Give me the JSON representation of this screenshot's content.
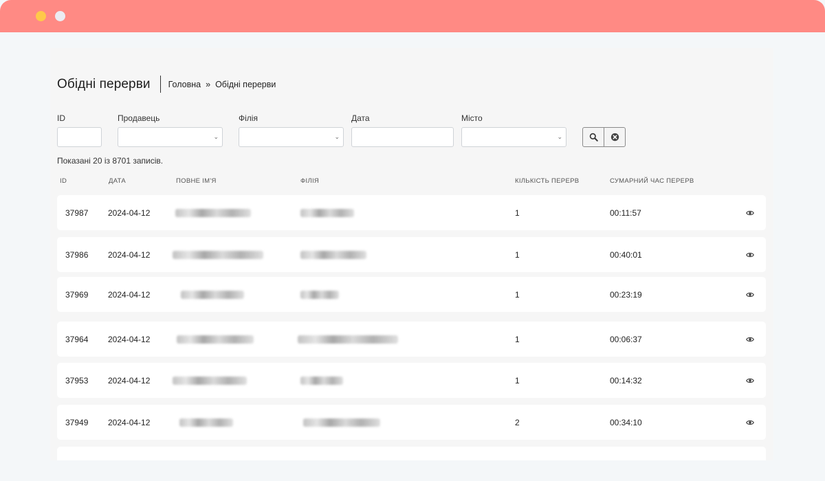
{
  "window": {
    "accent": "#ff8a84"
  },
  "header": {
    "title": "Обідні перерви",
    "breadcrumb": {
      "home": "Головна",
      "separator": "»",
      "current": "Обідні перерви"
    }
  },
  "filters": {
    "id_label": "ID",
    "seller_label": "Продавець",
    "branch_label": "Філія",
    "date_label": "Дата",
    "city_label": "Місто",
    "search_icon": "search-icon",
    "clear_icon": "clear-icon"
  },
  "summary": "Показані 20 із 8701 записів.",
  "table": {
    "columns": [
      "ID",
      "ДАТА",
      "ПОВНЕ ІМ'Я",
      "ФІЛІЯ",
      "КІЛЬКІСТЬ ПЕРЕРВ",
      "СУМАРНИЙ ЧАС ПЕРЕРВ"
    ],
    "rows": [
      {
        "id": "37987",
        "date": "2024-04-12",
        "count": "1",
        "total": "00:11:57"
      },
      {
        "id": "37986",
        "date": "2024-04-12",
        "count": "1",
        "total": "00:40:01"
      },
      {
        "id": "37969",
        "date": "2024-04-12",
        "count": "1",
        "total": "00:23:19"
      },
      {
        "id": "37964",
        "date": "2024-04-12",
        "count": "1",
        "total": "00:06:37"
      },
      {
        "id": "37953",
        "date": "2024-04-12",
        "count": "1",
        "total": "00:14:32"
      },
      {
        "id": "37949",
        "date": "2024-04-12",
        "count": "2",
        "total": "00:34:10"
      }
    ],
    "row_action_icon": "eye-icon"
  }
}
